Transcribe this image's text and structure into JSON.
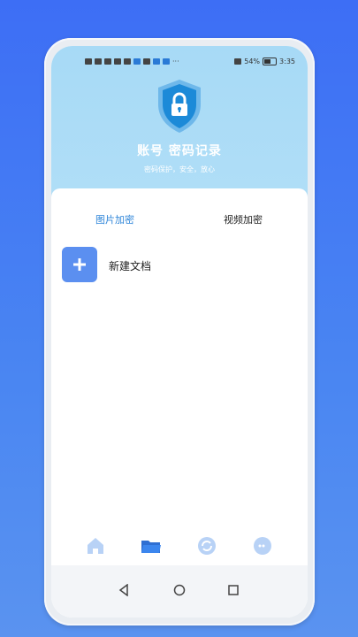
{
  "status_bar": {
    "battery_pct": "54%",
    "time": "3:35"
  },
  "header": {
    "title": "账号 密码记录",
    "subtitle": "密码保护，安全，放心"
  },
  "tabs": [
    {
      "label": "图片加密",
      "active": true
    },
    {
      "label": "视频加密",
      "active": false
    }
  ],
  "actions": {
    "new_doc_label": "新建文档"
  },
  "bottom_nav": [
    {
      "icon": "home-icon"
    },
    {
      "icon": "folder-icon"
    },
    {
      "icon": "sync-icon"
    },
    {
      "icon": "chat-icon"
    }
  ],
  "colors": {
    "accent": "#2f86d9",
    "header_bg": "#a7daf6",
    "button_bg": "#5b8ff0",
    "page_bg": "#3d6ef5"
  }
}
